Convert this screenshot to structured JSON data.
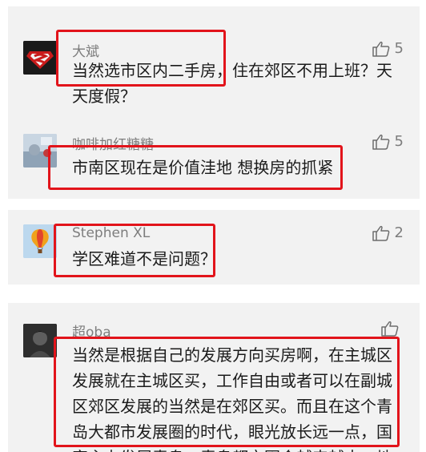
{
  "comments": [
    {
      "username": "大斌",
      "text": "当然选市区内二手房，住在郊区不用上班？天天度假？",
      "likes": "5"
    },
    {
      "username": "咖啡加红糖糖",
      "text": "市南区现在是价值洼地 想换房的抓紧",
      "likes": "5"
    },
    {
      "username": "Stephen XL",
      "text": "学区难道不是问题？",
      "likes": "2"
    },
    {
      "username": "超oba",
      "text": "当然是根据自己的发展方向买房啊，在主城区发展就在主城区买，工作自由或者可以在副城区郊区发展的当然是在郊区买。而且在这个青岛大都市发展圈的时代，眼光放长远一点，国家主力发展青岛，青岛都市圈会越来越大，地",
      "likes": ""
    }
  ],
  "icons": {
    "like": "thumbs-up-icon"
  },
  "colors": {
    "highlight": "#e2141b",
    "card_bg": "#f2f2f2",
    "username": "#7d7d7d"
  }
}
